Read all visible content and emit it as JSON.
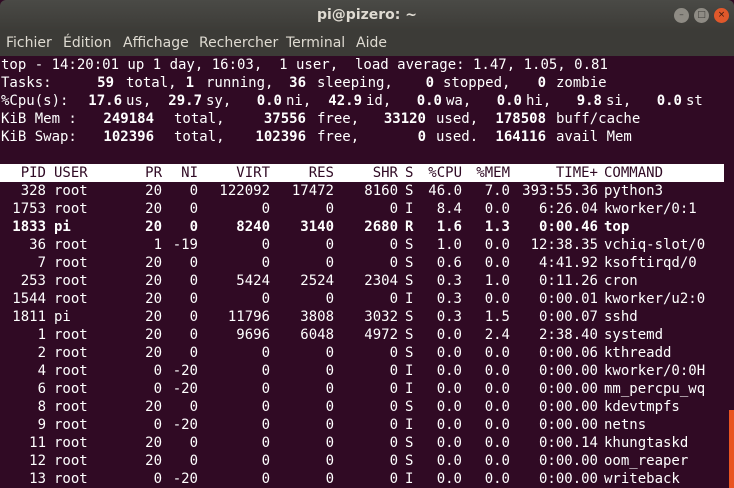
{
  "window": {
    "title": "pi@pizero: ~",
    "btn_min": "–",
    "btn_max": "□",
    "btn_close": "×"
  },
  "menu": [
    "Fichier",
    "Édition",
    "Affichage",
    "Rechercher",
    "Terminal",
    "Aide"
  ],
  "summary": {
    "uptime": "top - 14:20:01 up 1 day, 16:03,  1 user,  load average: 1.47, 1.05, 0.81",
    "tasks": {
      "label": "Tasks:",
      "total": "59",
      "t_total": "total,",
      "running": "1",
      "t_running": "running,",
      "sleeping": "36",
      "t_sleeping": "sleeping,",
      "stopped": "0",
      "t_stopped": "stopped,",
      "zombie": "0",
      "t_zombie": "zombie"
    },
    "cpu": {
      "label": "%Cpu(s):",
      "us": "17.6",
      "t_us": "us,",
      "sy": "29.7",
      "t_sy": "sy,",
      "ni": "0.0",
      "t_ni": "ni,",
      "id": "42.9",
      "t_id": "id,",
      "wa": "0.0",
      "t_wa": "wa,",
      "hi": "0.0",
      "t_hi": "hi,",
      "si": "9.8",
      "t_si": "si,",
      "st": "0.0",
      "t_st": "st"
    },
    "mem": {
      "label": "KiB Mem :",
      "total": "249184",
      "t_total": "total,",
      "free": "37556",
      "t_free": "free,",
      "used": "33120",
      "t_used": "used,",
      "cache": "178508",
      "t_cache": "buff/cache"
    },
    "swap": {
      "label": "KiB Swap:",
      "total": "102396",
      "t_total": "total,",
      "free": "102396",
      "t_free": "free,",
      "used": "0",
      "t_used": "used.",
      "avail": "164116",
      "t_avail": "avail Mem"
    }
  },
  "columns": [
    "PID",
    "USER",
    "PR",
    "NI",
    "VIRT",
    "RES",
    "SHR",
    "S",
    "%CPU",
    "%MEM",
    "TIME+",
    "COMMAND"
  ],
  "processes": [
    [
      "328",
      "root",
      "20",
      "0",
      "122092",
      "17472",
      "8160",
      "S",
      "46.0",
      "7.0",
      "393:55.36",
      "python3"
    ],
    [
      "1753",
      "root",
      "20",
      "0",
      "0",
      "0",
      "0",
      "I",
      "8.4",
      "0.0",
      "6:26.04",
      "kworker/0:1"
    ],
    [
      "1833",
      "pi",
      "20",
      "0",
      "8240",
      "3140",
      "2680",
      "R",
      "1.6",
      "1.3",
      "0:00.46",
      "top"
    ],
    [
      "36",
      "root",
      "1",
      "-19",
      "0",
      "0",
      "0",
      "S",
      "1.0",
      "0.0",
      "12:38.35",
      "vchiq-slot/0"
    ],
    [
      "7",
      "root",
      "20",
      "0",
      "0",
      "0",
      "0",
      "S",
      "0.6",
      "0.0",
      "4:41.92",
      "ksoftirqd/0"
    ],
    [
      "253",
      "root",
      "20",
      "0",
      "5424",
      "2524",
      "2304",
      "S",
      "0.3",
      "1.0",
      "0:11.26",
      "cron"
    ],
    [
      "1544",
      "root",
      "20",
      "0",
      "0",
      "0",
      "0",
      "I",
      "0.3",
      "0.0",
      "0:00.01",
      "kworker/u2:0"
    ],
    [
      "1811",
      "pi",
      "20",
      "0",
      "11796",
      "3808",
      "3032",
      "S",
      "0.3",
      "1.5",
      "0:00.07",
      "sshd"
    ],
    [
      "1",
      "root",
      "20",
      "0",
      "9696",
      "6048",
      "4972",
      "S",
      "0.0",
      "2.4",
      "2:38.40",
      "systemd"
    ],
    [
      "2",
      "root",
      "20",
      "0",
      "0",
      "0",
      "0",
      "S",
      "0.0",
      "0.0",
      "0:00.06",
      "kthreadd"
    ],
    [
      "4",
      "root",
      "0",
      "-20",
      "0",
      "0",
      "0",
      "I",
      "0.0",
      "0.0",
      "0:00.00",
      "kworker/0:0H"
    ],
    [
      "6",
      "root",
      "0",
      "-20",
      "0",
      "0",
      "0",
      "I",
      "0.0",
      "0.0",
      "0:00.00",
      "mm_percpu_wq"
    ],
    [
      "8",
      "root",
      "20",
      "0",
      "0",
      "0",
      "0",
      "S",
      "0.0",
      "0.0",
      "0:00.00",
      "kdevtmpfs"
    ],
    [
      "9",
      "root",
      "0",
      "-20",
      "0",
      "0",
      "0",
      "I",
      "0.0",
      "0.0",
      "0:00.00",
      "netns"
    ],
    [
      "11",
      "root",
      "20",
      "0",
      "0",
      "0",
      "0",
      "S",
      "0.0",
      "0.0",
      "0:00.14",
      "khungtaskd"
    ],
    [
      "12",
      "root",
      "20",
      "0",
      "0",
      "0",
      "0",
      "S",
      "0.0",
      "0.0",
      "0:00.00",
      "oom_reaper"
    ],
    [
      "13",
      "root",
      "0",
      "-20",
      "0",
      "0",
      "0",
      "I",
      "0.0",
      "0.0",
      "0:00.00",
      "writeback"
    ]
  ],
  "highlighted_pid": "1833",
  "colors": {
    "terminal_bg": "#300a24",
    "titlebar": "#3c3b37",
    "accent": "#e95420"
  }
}
